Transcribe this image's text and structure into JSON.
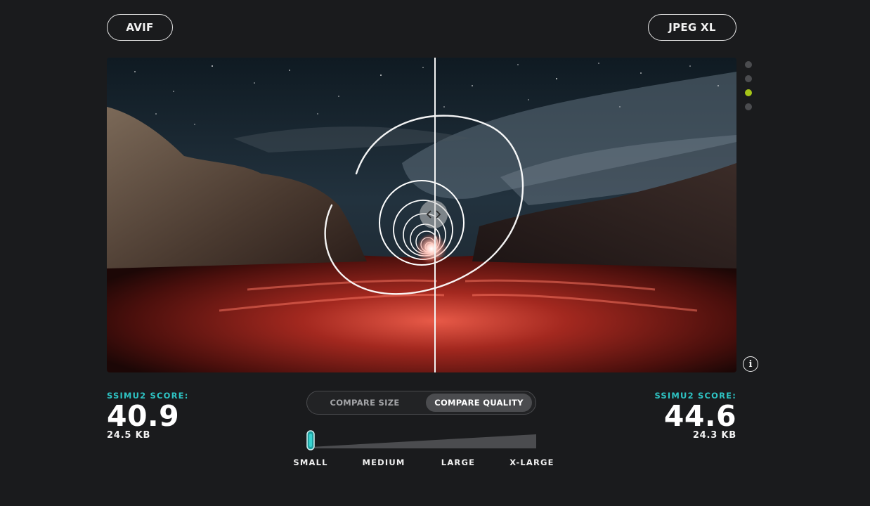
{
  "formats": {
    "left": "AVIF",
    "right": "JPEG XL"
  },
  "image_dots": {
    "count": 4,
    "active_index": 2
  },
  "info_icon_glyph": "i",
  "scores": {
    "left": {
      "label": "SSIMU2 SCORE:",
      "value": "40.9",
      "size": "24.5 KB"
    },
    "right": {
      "label": "SSIMU2 SCORE:",
      "value": "44.6",
      "size": "24.3 KB"
    }
  },
  "toggle": {
    "options": [
      "COMPARE SIZE",
      "COMPARE QUALITY"
    ],
    "selected": "COMPARE QUALITY"
  },
  "size_slider": {
    "labels": [
      "SMALL",
      "MEDIUM",
      "LARGE",
      "X-LARGE"
    ],
    "selected": "SMALL",
    "value": 0
  },
  "comparison_divider_fraction": 0.52,
  "colors": {
    "accent_teal": "#2ec4c4",
    "active_dot": "#a6c518",
    "background": "#1a1b1d"
  }
}
